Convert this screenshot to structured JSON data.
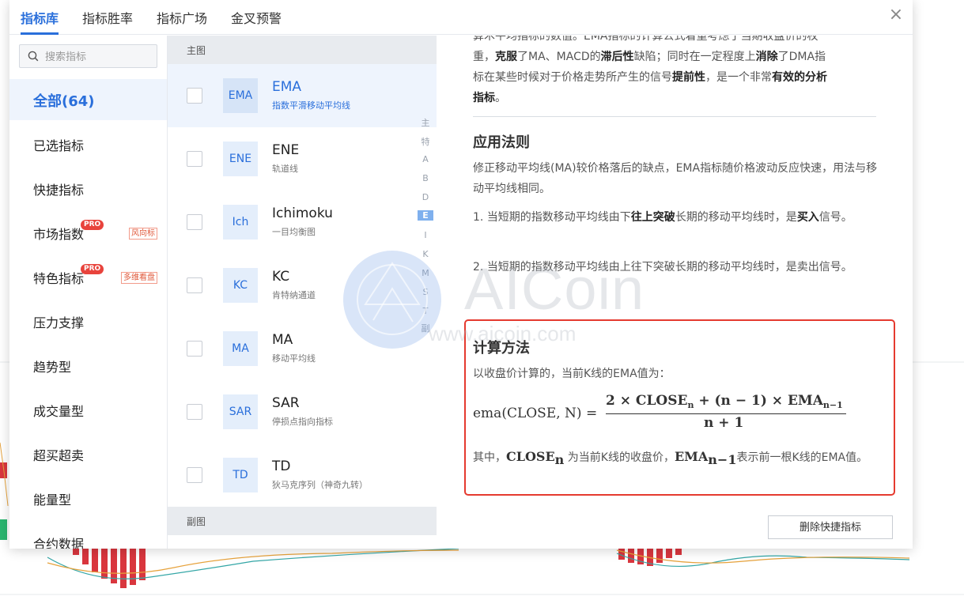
{
  "tabs": [
    {
      "label": "指标库",
      "active": true
    },
    {
      "label": "指标胜率"
    },
    {
      "label": "指标广场"
    },
    {
      "label": "金叉预警"
    }
  ],
  "close_icon": "close-icon",
  "search": {
    "placeholder": "搜索指标",
    "value": ""
  },
  "categories": [
    {
      "label": "全部(64)",
      "active": true
    },
    {
      "label": "已选指标"
    },
    {
      "label": "快捷指标"
    },
    {
      "label": "市场指数",
      "badge": "PRO",
      "tag": "风向标"
    },
    {
      "label": "特色指标",
      "badge": "PRO",
      "tag": "多维看盘"
    },
    {
      "label": "压力支撑"
    },
    {
      "label": "趋势型"
    },
    {
      "label": "成交量型"
    },
    {
      "label": "超买超卖"
    },
    {
      "label": "能量型"
    },
    {
      "label": "合约数据"
    }
  ],
  "main_section": "主图",
  "sub_section": "副图",
  "indicators": [
    {
      "abbr": "EMA",
      "name": "EMA",
      "desc": "指数平滑移动平均线",
      "active": true
    },
    {
      "abbr": "ENE",
      "name": "ENE",
      "desc": "轨道线"
    },
    {
      "abbr": "Ich",
      "name": "Ichimoku",
      "desc": "一目均衡图"
    },
    {
      "abbr": "KC",
      "name": "KC",
      "desc": "肯特纳通道"
    },
    {
      "abbr": "MA",
      "name": "MA",
      "desc": "移动平均线"
    },
    {
      "abbr": "SAR",
      "name": "SAR",
      "desc": "停损点指向指标"
    },
    {
      "abbr": "TD",
      "name": "TD",
      "desc": "狄马克序列（神奇九转）"
    }
  ],
  "alpha_index": [
    "主",
    "特",
    "A",
    "B",
    "D",
    "E",
    "I",
    "K",
    "M",
    "S",
    "T",
    "副"
  ],
  "alpha_active": "E",
  "detail": {
    "intro_line1": "算术平均指标的数值。EMA指标的计算公式着重考虑了当期收盘价的权",
    "intro_line2_parts": [
      "重，",
      "克服",
      "了MA、MACD的",
      "滞后性",
      "缺陷；同时在一定程度上",
      "消除",
      "了DMA指"
    ],
    "intro_line3_parts": [
      "标在某些时候对于价格走势所产生的信号",
      "提前性",
      "，是一个非常",
      "有效的分析"
    ],
    "intro_line4": "指标",
    "intro_line4_end": "。",
    "rule_title": "应用法则",
    "rule_text": "修正移动平均线(MA)较价格落后的缺点，EMA指标随价格波动反应快速，用法与移动平均线相同。",
    "rule1_parts": [
      "1. 当短期的指数移动平均线由下",
      "往上突破",
      "长期的移动平均线时，是",
      "买入",
      "信号。"
    ],
    "rule2": "2. 当短期的指数移动平均线由上往下突破长期的移动平均线时，是卖出信号。",
    "calc_title": "计算方法",
    "calc_text": "以收盘价计算的，当前K线的EMA值为：",
    "formula_lhs": "ema(CLOSE, N) =",
    "formula_num_a": "2 × CLOSE",
    "formula_num_a_sub": "n",
    "formula_num_b": " + (n − 1) × EMA",
    "formula_num_b_sub": "n−1",
    "formula_den": "n + 1",
    "where_prefix": "其中，",
    "where_close": "CLOSE",
    "where_close_sub": "n",
    "where_mid": " 为当前K线的收盘价，",
    "where_ema": "EMA",
    "where_ema_sub": "n−1",
    "where_suffix": "表示前一根K线的EMA值。"
  },
  "delete_button": "删除快捷指标",
  "watermark": {
    "brand": "AICoin",
    "url": "www.aicoin.com"
  },
  "colors": {
    "accent": "#2a6fdb",
    "highlight_border": "#e53a2f",
    "pro_badge": "#e8433c",
    "up_candle": "#2ab56f",
    "down_candle": "#d9363e"
  }
}
